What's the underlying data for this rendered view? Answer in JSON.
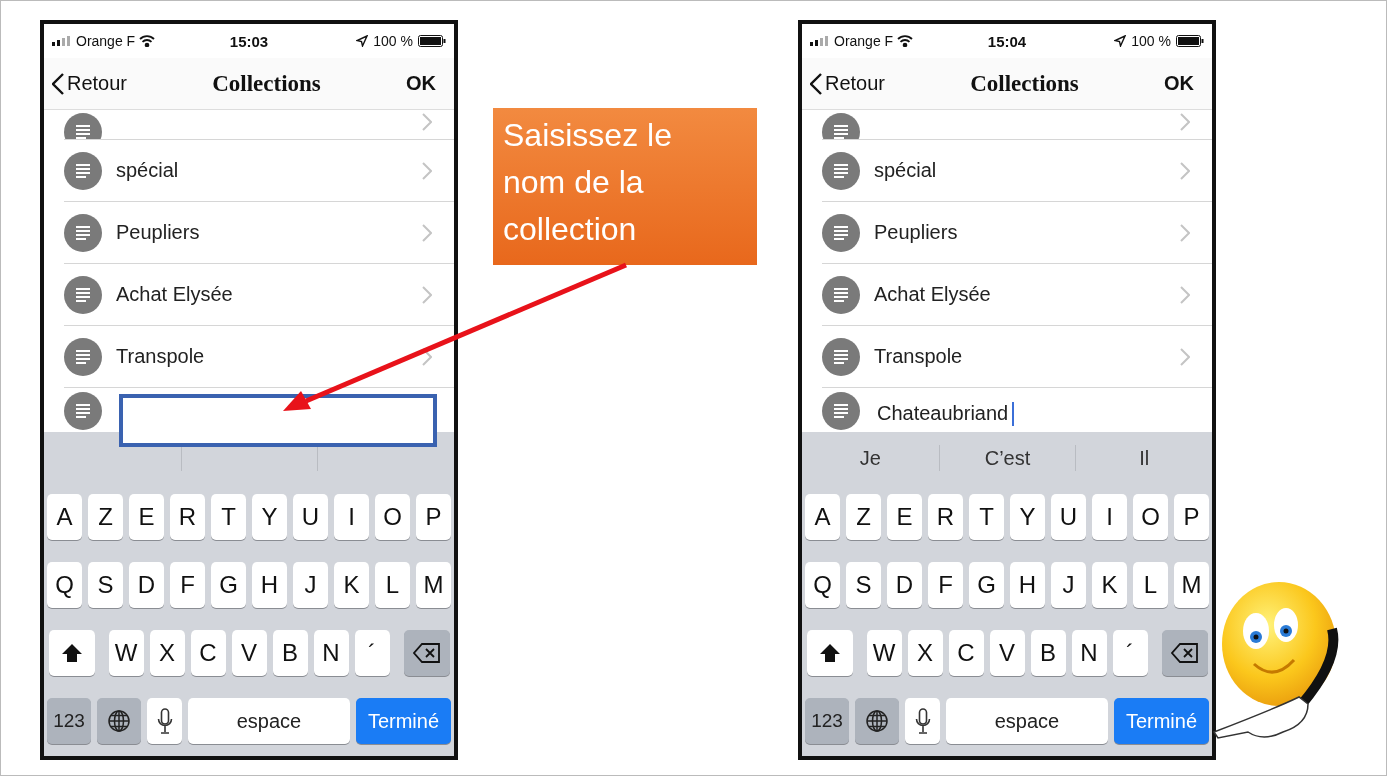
{
  "callout": {
    "text": "Saisissez le nom de la collection"
  },
  "phones": [
    {
      "status_bar": {
        "carrier": "Orange F",
        "time": "15:03",
        "battery": "100 %"
      },
      "nav": {
        "back": "Retour",
        "title": "Collections",
        "action": "OK"
      },
      "collections": [
        "spécial",
        "Peupliers",
        "Achat Elysée",
        "Transpole"
      ],
      "new_collection": {
        "highlighted": true,
        "cursor": false
      },
      "keyboard": {
        "rows": [
          {
            "keys": [
              {
                "kind": "letter",
                "label": "A"
              },
              {
                "kind": "letter",
                "label": "Z"
              },
              {
                "kind": "letter",
                "label": "E"
              },
              {
                "kind": "letter",
                "label": "R"
              },
              {
                "kind": "letter",
                "label": "T"
              },
              {
                "kind": "letter",
                "label": "Y"
              },
              {
                "kind": "letter",
                "label": "U"
              },
              {
                "kind": "letter",
                "label": "I"
              },
              {
                "kind": "letter",
                "label": "O"
              },
              {
                "kind": "letter",
                "label": "P"
              }
            ]
          },
          {
            "keys": [
              {
                "kind": "letter",
                "label": "Q"
              },
              {
                "kind": "letter",
                "label": "S"
              },
              {
                "kind": "letter",
                "label": "D"
              },
              {
                "kind": "letter",
                "label": "F"
              },
              {
                "kind": "letter",
                "label": "G"
              },
              {
                "kind": "letter",
                "label": "H"
              },
              {
                "kind": "letter",
                "label": "J"
              },
              {
                "kind": "letter",
                "label": "K"
              },
              {
                "kind": "letter",
                "label": "L"
              },
              {
                "kind": "letter",
                "label": "M"
              }
            ]
          },
          {
            "keys": [
              {
                "kind": "shift"
              },
              {
                "kind": "letter",
                "label": "W"
              },
              {
                "kind": "letter",
                "label": "X"
              },
              {
                "kind": "letter",
                "label": "C"
              },
              {
                "kind": "letter",
                "label": "V"
              },
              {
                "kind": "letter",
                "label": "B"
              },
              {
                "kind": "letter",
                "label": "N"
              },
              {
                "kind": "letter",
                "label": "´"
              },
              {
                "kind": "delete"
              }
            ]
          },
          {
            "keys": [
              {
                "kind": "mode",
                "label": "123"
              },
              {
                "kind": "globe"
              },
              {
                "kind": "mic"
              },
              {
                "kind": "space",
                "label": "espace"
              },
              {
                "kind": "done",
                "label": "Terminé"
              }
            ]
          }
        ]
      }
    },
    {
      "status_bar": {
        "carrier": "Orange F",
        "time": "15:04",
        "battery": "100 %"
      },
      "nav": {
        "back": "Retour",
        "title": "Collections",
        "action": "OK"
      },
      "collections": [
        "spécial",
        "Peupliers",
        "Achat Elysée",
        "Transpole"
      ],
      "new_collection": {
        "value": "Chateaubriand",
        "highlighted": false,
        "cursor": true
      },
      "suggestions": [
        "Je",
        "C’est",
        "Il"
      ],
      "keyboard": {
        "rows": [
          {
            "keys": [
              {
                "kind": "letter",
                "label": "A"
              },
              {
                "kind": "letter",
                "label": "Z"
              },
              {
                "kind": "letter",
                "label": "E"
              },
              {
                "kind": "letter",
                "label": "R"
              },
              {
                "kind": "letter",
                "label": "T"
              },
              {
                "kind": "letter",
                "label": "Y"
              },
              {
                "kind": "letter",
                "label": "U"
              },
              {
                "kind": "letter",
                "label": "I"
              },
              {
                "kind": "letter",
                "label": "O"
              },
              {
                "kind": "letter",
                "label": "P"
              }
            ]
          },
          {
            "keys": [
              {
                "kind": "letter",
                "label": "Q"
              },
              {
                "kind": "letter",
                "label": "S"
              },
              {
                "kind": "letter",
                "label": "D"
              },
              {
                "kind": "letter",
                "label": "F"
              },
              {
                "kind": "letter",
                "label": "G"
              },
              {
                "kind": "letter",
                "label": "H"
              },
              {
                "kind": "letter",
                "label": "J"
              },
              {
                "kind": "letter",
                "label": "K"
              },
              {
                "kind": "letter",
                "label": "L"
              },
              {
                "kind": "letter",
                "label": "M"
              }
            ]
          },
          {
            "keys": [
              {
                "kind": "shift"
              },
              {
                "kind": "letter",
                "label": "W"
              },
              {
                "kind": "letter",
                "label": "X"
              },
              {
                "kind": "letter",
                "label": "C"
              },
              {
                "kind": "letter",
                "label": "V"
              },
              {
                "kind": "letter",
                "label": "B"
              },
              {
                "kind": "letter",
                "label": "N"
              },
              {
                "kind": "letter",
                "label": "´"
              },
              {
                "kind": "delete"
              }
            ]
          },
          {
            "keys": [
              {
                "kind": "mode",
                "label": "123"
              },
              {
                "kind": "globe"
              },
              {
                "kind": "mic"
              },
              {
                "kind": "space",
                "label": "espace"
              },
              {
                "kind": "done",
                "label": "Terminé"
              }
            ]
          }
        ]
      }
    }
  ]
}
